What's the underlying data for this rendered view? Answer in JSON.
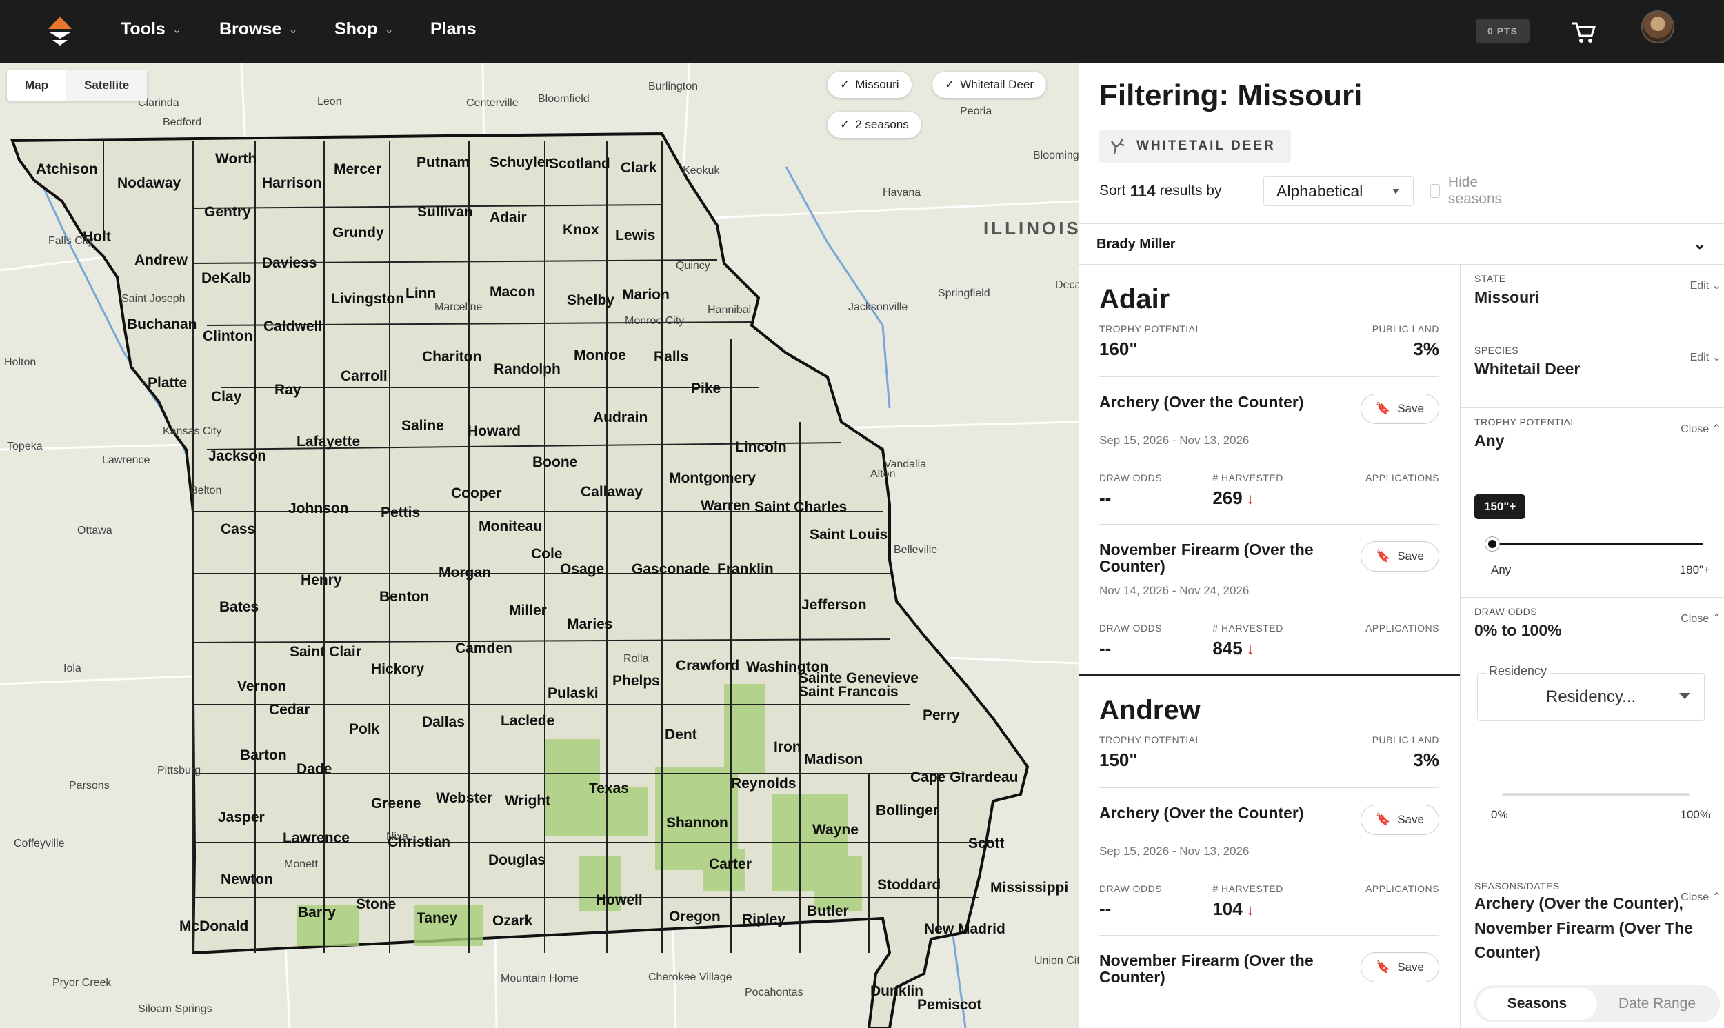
{
  "nav": {
    "items": [
      {
        "label": "Tools",
        "chevron": true
      },
      {
        "label": "Browse",
        "chevron": true
      },
      {
        "label": "Shop",
        "chevron": true
      },
      {
        "label": "Plans",
        "chevron": false
      }
    ],
    "points": "0 PTS"
  },
  "map": {
    "toggle": [
      "Map",
      "Satellite"
    ],
    "active_toggle": "Satellite",
    "chips": [
      "Missouri",
      "Whitetail Deer",
      "2 seasons"
    ],
    "state_label": "ILLINOIS",
    "counties": [
      "Atchison",
      "Nodaway",
      "Worth",
      "Harrison",
      "Mercer",
      "Putnam",
      "Schuyler",
      "Scotland",
      "Clark",
      "Holt",
      "Andrew",
      "Gentry",
      "Daviess",
      "Grundy",
      "Sullivan",
      "Adair",
      "Knox",
      "Lewis",
      "Buchanan",
      "DeKalb",
      "Caldwell",
      "Livingston",
      "Linn",
      "Macon",
      "Shelby",
      "Marion",
      "Platte",
      "Clinton",
      "Ray",
      "Carroll",
      "Chariton",
      "Randolph",
      "Monroe",
      "Ralls",
      "Clay",
      "Jackson",
      "Lafayette",
      "Saline",
      "Howard",
      "Boone",
      "Audrain",
      "Pike",
      "Lincoln",
      "Cass",
      "Johnson",
      "Pettis",
      "Cooper",
      "Moniteau",
      "Callaway",
      "Montgomery",
      "Warren",
      "Saint Charles",
      "Saint Louis",
      "Bates",
      "Henry",
      "Benton",
      "Morgan",
      "Cole",
      "Osage",
      "Gasconade",
      "Franklin",
      "Jefferson",
      "Vernon",
      "Saint Clair",
      "Hickory",
      "Camden",
      "Miller",
      "Maries",
      "Crawford",
      "Washington",
      "Sainte Genevieve",
      "Saint Francois",
      "Cedar",
      "Polk",
      "Dallas",
      "Laclede",
      "Pulaski",
      "Phelps",
      "Dent",
      "Iron",
      "Perry",
      "Barton",
      "Dade",
      "Madison",
      "Reynolds",
      "Cape Girardeau",
      "Bollinger",
      "Jasper",
      "Greene",
      "Webster",
      "Wright",
      "Texas",
      "Shannon",
      "Wayne",
      "Lawrence",
      "Christian",
      "Douglas",
      "Carter",
      "Scott",
      "Stoddard",
      "Mississippi",
      "Newton",
      "Barry",
      "Stone",
      "Taney",
      "Ozark",
      "Howell",
      "Oregon",
      "Ripley",
      "Butler",
      "McDonald",
      "New Madrid",
      "Dunklin",
      "Pemiscot"
    ],
    "towns": [
      "Burlington",
      "Clarinda",
      "Bedford",
      "Leon",
      "Centerville",
      "Bloomfield",
      "Peoria",
      "Keokuk",
      "Havana",
      "Quincy",
      "Hannibal",
      "Jacksonville",
      "Springfield",
      "Falls City",
      "Saint Joseph",
      "Holton",
      "Topeka",
      "Lawrence",
      "Kansas City",
      "Belton",
      "Ottawa",
      "Marceline",
      "Monroe City",
      "Vandalia",
      "Alton",
      "Belleville",
      "Iola",
      "Rolla",
      "Parsons",
      "Pittsburg",
      "Coffeyville",
      "Monett",
      "Nixa",
      "Pryor Creek",
      "Siloam Springs",
      "Mountain Home",
      "Cherokee Village",
      "Pocahontas",
      "Union City",
      "Decatur",
      "Bloomington"
    ]
  },
  "panel": {
    "title": "Filtering: Missouri",
    "species_badge": "WHITETAIL DEER",
    "sort_prefix": "Sort",
    "result_count": "114",
    "sort_suffix": "results by",
    "sort_value": "Alphabetical",
    "hide_seasons": "Hide seasons",
    "user": "Brady Miller"
  },
  "results": [
    {
      "unit": "Adair",
      "trophy_label": "TROPHY POTENTIAL",
      "trophy": "160\"",
      "public_label": "PUBLIC LAND",
      "public": "3%",
      "seasons": [
        {
          "name": "Archery (Over the Counter)",
          "save": "Save",
          "dates": "Sep 15, 2026 - Nov 13, 2026",
          "draw_label": "DRAW ODDS",
          "draw": "--",
          "harvest_label": "# HARVESTED",
          "harvest": "269",
          "apps_label": "APPLICATIONS",
          "apps": ""
        },
        {
          "name": "November Firearm (Over the Counter)",
          "save": "Save",
          "dates": "Nov 14, 2026 - Nov 24, 2026",
          "draw_label": "DRAW ODDS",
          "draw": "--",
          "harvest_label": "# HARVESTED",
          "harvest": "845",
          "apps_label": "APPLICATIONS",
          "apps": ""
        }
      ]
    },
    {
      "unit": "Andrew",
      "trophy_label": "TROPHY POTENTIAL",
      "trophy": "150\"",
      "public_label": "PUBLIC LAND",
      "public": "3%",
      "seasons": [
        {
          "name": "Archery (Over the Counter)",
          "save": "Save",
          "dates": "Sep 15, 2026 - Nov 13, 2026",
          "draw_label": "DRAW ODDS",
          "draw": "--",
          "harvest_label": "# HARVESTED",
          "harvest": "104",
          "apps_label": "APPLICATIONS",
          "apps": ""
        },
        {
          "name": "November Firearm (Over the Counter)",
          "save": "Save",
          "dates": "",
          "draw_label": "",
          "draw": "",
          "harvest_label": "",
          "harvest": "",
          "apps_label": "",
          "apps": ""
        }
      ]
    }
  ],
  "filters": {
    "state": {
      "label": "STATE",
      "value": "Missouri",
      "action": "Edit"
    },
    "species": {
      "label": "SPECIES",
      "value": "Whitetail Deer",
      "action": "Edit"
    },
    "trophy": {
      "label": "TROPHY POTENTIAL",
      "value": "Any",
      "action": "Close",
      "tooltip": "150\"+",
      "min": "Any",
      "max": "180\"+",
      "level_fraction": 0
    },
    "draw": {
      "label": "DRAW ODDS",
      "value": "0% to 100%",
      "action": "Close",
      "residency_label": "Residency",
      "residency_value": "Residency...",
      "min": "0%",
      "max": "100%"
    },
    "seasons": {
      "label": "SEASONS/DATES",
      "value": "Archery (Over the Counter), November Firearm (Over The Counter)",
      "action": "Close",
      "tabs": [
        "Seasons",
        "Date Range"
      ],
      "active_tab": "Seasons"
    }
  },
  "colors": {
    "nav_bg": "#1c1c1c",
    "accent": "#e8772e",
    "harvest_down": "#d02020",
    "public_land": "#8fbf5a",
    "map_fill": "#e2e2d2"
  }
}
